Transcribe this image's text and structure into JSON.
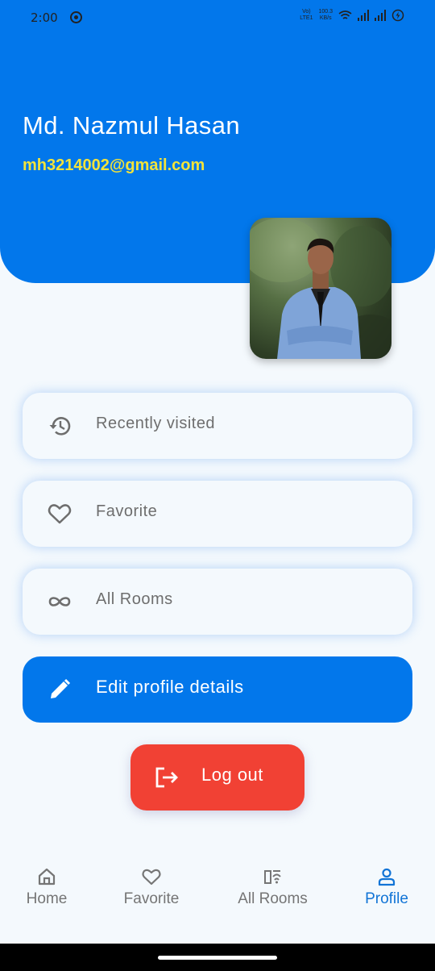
{
  "status_bar": {
    "time": "2:00",
    "network_top": "Vo)",
    "network_bottom": "LTE1",
    "speed_value": "100.3",
    "speed_unit": "KB/s"
  },
  "profile": {
    "name": "Md. Nazmul Hasan",
    "email": "mh3214002@gmail.com"
  },
  "menu": {
    "recently_visited": "Recently visited",
    "favorite": "Favorite",
    "all_rooms": "All Rooms",
    "edit_profile": "Edit profile details",
    "logout": "Log out"
  },
  "bottom_nav": {
    "items": [
      {
        "label": "Home",
        "icon": "home-icon"
      },
      {
        "label": "Favorite",
        "icon": "heart-icon"
      },
      {
        "label": "All Rooms",
        "icon": "rooms-icon"
      },
      {
        "label": "Profile",
        "icon": "person-icon",
        "active": true
      }
    ]
  },
  "colors": {
    "header": "#0277EB",
    "email": "#F2E33B",
    "logout": "#F14134",
    "active_nav": "#1174D6"
  }
}
